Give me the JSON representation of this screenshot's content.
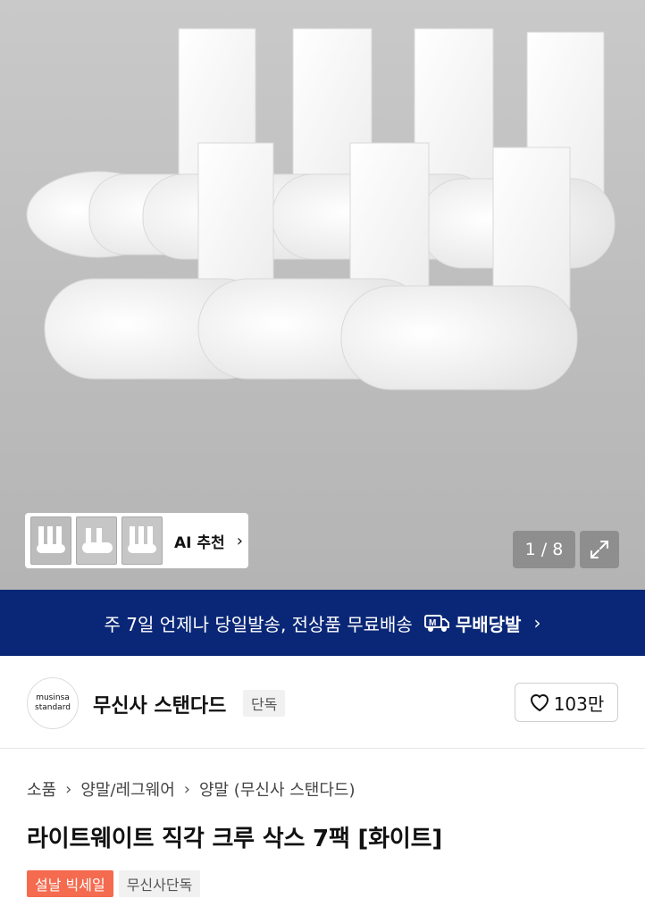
{
  "gallery": {
    "counter": "1 / 8",
    "ai_label": "AI 추천",
    "icons": {
      "expand": "expand-arrows-icon",
      "chevron": "chevron-right-icon"
    }
  },
  "banner": {
    "text": "주 7일 언제나 당일발송, 전상품 무료배송",
    "badge_label": "무배당발",
    "badge_icon": "delivery-truck-m-icon",
    "color": "#0a2777"
  },
  "brand": {
    "logo_line1": "musinsa",
    "logo_line2": "standard",
    "name": "무신사 스탠다드",
    "tag": "단독",
    "like_count": "103만",
    "like_icon": "heart-outline-icon"
  },
  "breadcrumb": [
    "소품",
    "양말/레그웨어",
    "양말 (무신사 스탠다드)"
  ],
  "product": {
    "title": "라이트웨이트 직각 크루 삭스 7팩 [화이트]",
    "tags": [
      "설날 빅세일",
      "무신사단독"
    ],
    "sale_tag_color": "#f46b4f"
  }
}
